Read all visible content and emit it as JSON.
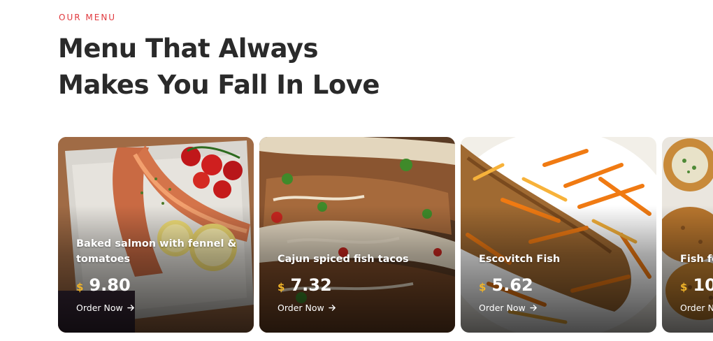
{
  "section": {
    "eyebrow": "OUR MENU",
    "heading_line1": "Menu That Always",
    "heading_line2": "Makes You Fall In Love"
  },
  "currency_symbol": "$",
  "order_label": "Order Now",
  "order_icon": "arrow-right-icon",
  "colors": {
    "accent": "#e0393e",
    "currency": "#f0b429",
    "heading": "#2a2a2a"
  },
  "menu_items": [
    {
      "name": "Baked salmon with fennel & tomatoes",
      "price": "9.80",
      "photo": "baked-salmon-photo"
    },
    {
      "name": "Cajun spiced fish tacos",
      "price": "7.32",
      "photo": "fish-tacos-photo"
    },
    {
      "name": "Escovitch Fish",
      "price": "5.62",
      "photo": "escovitch-fish-photo"
    },
    {
      "name": "Fish fo",
      "price": "10",
      "photo": "fish-croquettes-photo"
    }
  ]
}
